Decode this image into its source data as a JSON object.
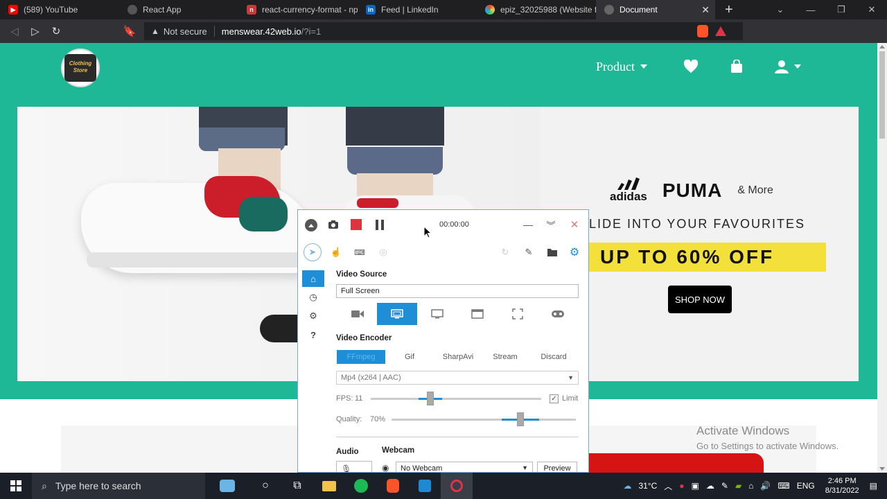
{
  "browser": {
    "tabs": [
      {
        "title": "(589) YouTube",
        "favicon_color": "#ff0000"
      },
      {
        "title": "React App",
        "favicon_color": "#777777"
      },
      {
        "title": "react-currency-format - np",
        "favicon_color": "#cb3837"
      },
      {
        "title": "Feed | LinkedIn",
        "favicon_color": "#0a66c2"
      },
      {
        "title": "epiz_32025988 (Website fo",
        "favicon_color": "#e34c26"
      },
      {
        "title": "Document",
        "favicon_color": "#777777",
        "active": true
      }
    ],
    "url": {
      "security_label": "Not secure",
      "host": "menswear.42web.io",
      "path": "/?i=1"
    }
  },
  "site": {
    "logo_text": "Clothing Store",
    "nav": {
      "product_label": "Product"
    },
    "banner": {
      "brands": [
        "adidas",
        "PUMA"
      ],
      "more_label": "& More",
      "slide_text": "LIDE INTO YOUR FAVOURITES",
      "offer_text": "UP TO 60% OFF",
      "shop_button": "SHOP NOW"
    },
    "accent_color": "#1fb896",
    "activate": {
      "title": "Activate Windows",
      "subtitle": "Go to Settings to activate Windows."
    }
  },
  "recorder": {
    "timer": "00:00:00",
    "video_source": {
      "label": "Video Source",
      "value": "Full Screen"
    },
    "video_encoder": {
      "label": "Video Encoder",
      "tabs": [
        "FFmpeg",
        "Gif",
        "SharpAvi",
        "Stream",
        "Discard"
      ],
      "selected": "FFmpeg",
      "codec": "Mp4 (x264 | AAC)"
    },
    "fps": {
      "label": "FPS:",
      "value": "11",
      "limit_label": "Limit",
      "level": 0.35
    },
    "quality": {
      "label": "Quality:",
      "value": "70%",
      "level": 0.7
    },
    "audio_label": "Audio",
    "webcam": {
      "label": "Webcam",
      "value": "No Webcam",
      "preview_label": "Preview"
    }
  },
  "taskbar": {
    "search_placeholder": "Type here to search",
    "weather": "31°C",
    "language": "ENG",
    "time": "2:46 PM",
    "date": "8/31/2022"
  }
}
